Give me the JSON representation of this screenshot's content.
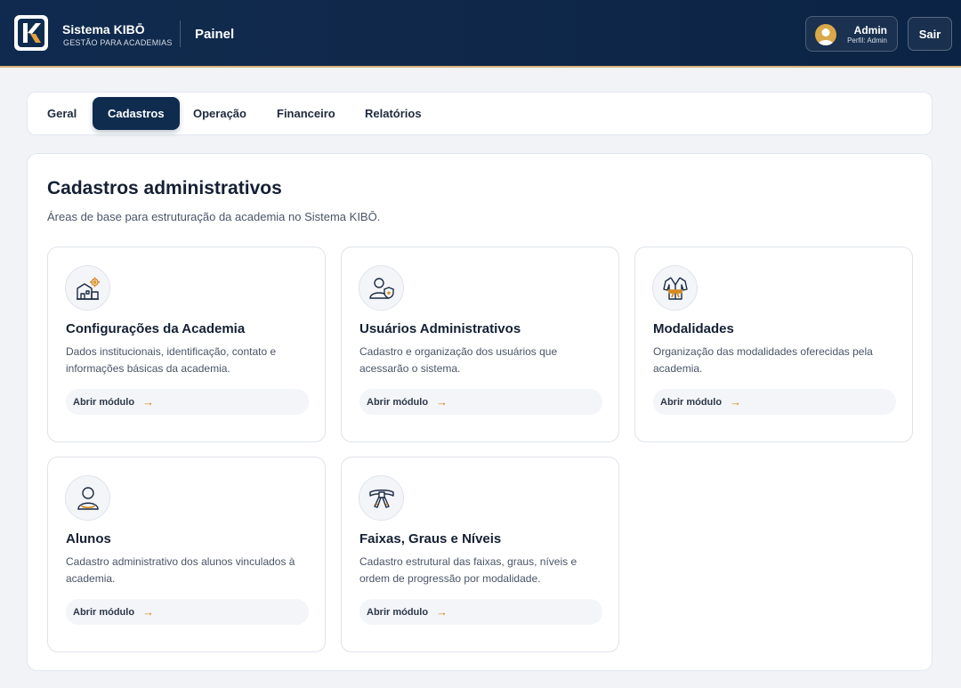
{
  "header": {
    "brand_name": "Sistema KIBŌ",
    "brand_sub": "GESTÃO PARA ACADEMIAS",
    "page_title": "Painel",
    "user_name": "Admin",
    "user_role": "Perfil: Admin",
    "logout_label": "Sair"
  },
  "tabs": [
    {
      "label": "Geral",
      "active": false
    },
    {
      "label": "Cadastros",
      "active": true
    },
    {
      "label": "Operação",
      "active": false
    },
    {
      "label": "Financeiro",
      "active": false
    },
    {
      "label": "Relatórios",
      "active": false
    }
  ],
  "main": {
    "title": "Cadastros administrativos",
    "subtitle": "Áreas de base para estruturação da academia no Sistema KIBŌ.",
    "cards": [
      {
        "icon": "academy-settings-icon",
        "title": "Configurações da Academia",
        "description": "Dados institucionais, identificação, contato e informações básicas da academia.",
        "link_label": "Abrir módulo",
        "link_arrow": "→"
      },
      {
        "icon": "admin-user-icon",
        "title": "Usuários Administrativos",
        "description": "Cadastro e organização dos usuários que acessarão o sistema.",
        "link_label": "Abrir módulo",
        "link_arrow": "→"
      },
      {
        "icon": "kimono-icon",
        "title": "Modalidades",
        "description": "Organização das modalidades oferecidas pela academia.",
        "link_label": "Abrir módulo",
        "link_arrow": "→"
      },
      {
        "icon": "student-icon",
        "title": "Alunos",
        "description": "Cadastro administrativo dos alunos vinculados à academia.",
        "link_label": "Abrir módulo",
        "link_arrow": "→"
      },
      {
        "icon": "belt-icon",
        "title": "Faixas, Graus e Níveis",
        "description": "Cadastro estrutural das faixas, graus, níveis e ordem de progressão por modalidade.",
        "link_label": "Abrir módulo",
        "link_arrow": "→"
      }
    ]
  },
  "colors": {
    "header_bg": "#0f2a4e",
    "accent_gold": "#d68a1f",
    "active_tab": "#0f2c4f"
  }
}
